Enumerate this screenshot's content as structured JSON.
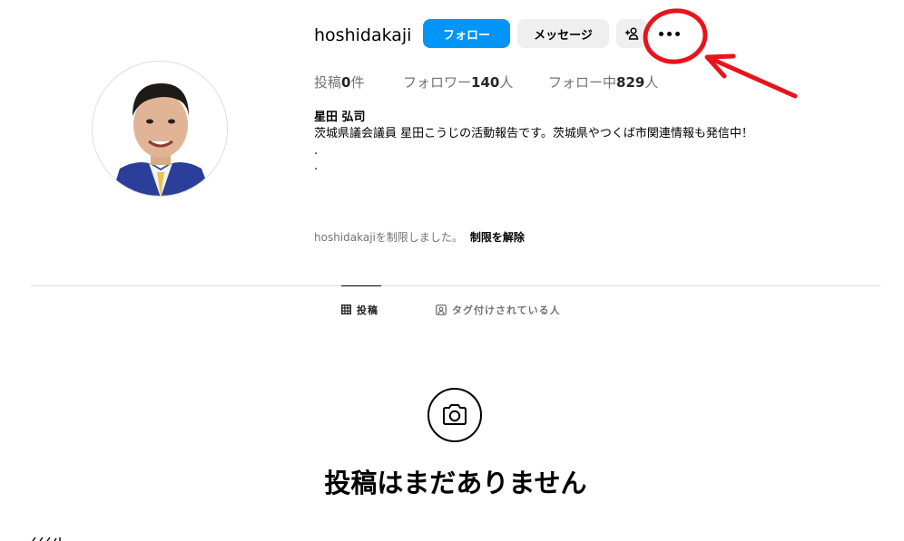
{
  "profile": {
    "username": "hoshidakaji",
    "full_name": "星田 弘司",
    "bio_line": "茨城県議会議員 星田こうじの活動報告です。茨城県やつくば市関連情報も発信中！",
    "bio_dot_1": ".",
    "bio_dot_2": "."
  },
  "actions": {
    "follow_label": "フォロー",
    "message_label": "メッセージ",
    "add_user_icon": "person-plus-icon",
    "more_icon": "more-options-icon"
  },
  "stats": {
    "posts_label": "投稿",
    "posts_count": "0",
    "posts_suffix": "件",
    "followers_label": "フォロワー",
    "followers_count": "140",
    "followers_suffix": "人",
    "following_label": "フォロー中",
    "following_count": "829",
    "following_suffix": "人"
  },
  "restriction": {
    "message": "hoshidakajiを制限しました。",
    "unrestrict_label": "制限を解除"
  },
  "tabs": [
    {
      "label": "投稿",
      "icon": "grid-icon",
      "active": true
    },
    {
      "label": "タグ付けされている人",
      "icon": "tagged-person-icon",
      "active": false
    }
  ],
  "empty_state": {
    "icon": "camera-icon",
    "title": "投稿はまだありません"
  },
  "annotation": {
    "color": "#e8141c"
  },
  "colors": {
    "follow_button": "#0095f6",
    "secondary_button": "#efefef",
    "muted_text": "#737373",
    "divider": "#dbdbdb"
  }
}
